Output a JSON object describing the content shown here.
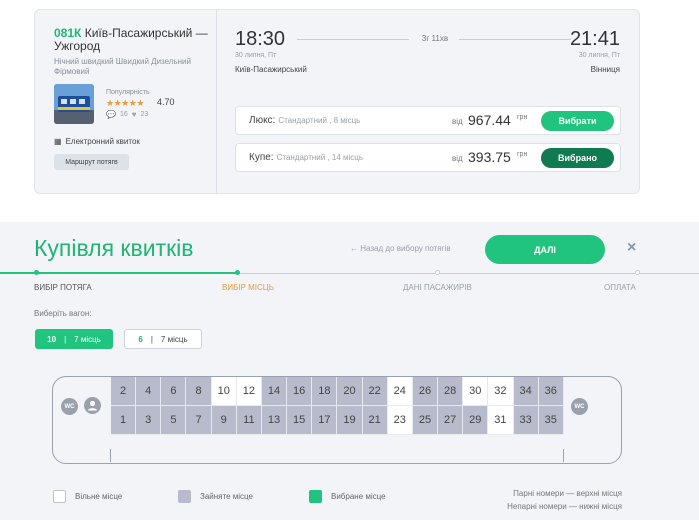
{
  "train": {
    "number": "081К",
    "route": "Київ-Пасажирський — Ужгород",
    "type": "Нічний швидкий Швидкий Дизельний Фірмовий",
    "popularity_label": "Популярність",
    "rating_stars": 4.5,
    "rating": "4.70",
    "comments": "16",
    "likes": "23",
    "eticket": "Електронний квиток",
    "route_button": "Маршрут потягв",
    "photo_icon": "train-photo"
  },
  "schedule": {
    "dep_time": "18:30",
    "arr_time": "21:41",
    "duration": "3г 11хв",
    "dep_date": "30 липня, Пт",
    "arr_date": "30 липня, Пт",
    "dep_station": "Київ-Пасажирський",
    "arr_station": "Вінниця"
  },
  "classes": [
    {
      "name": "Люкс:",
      "avail": "Стандартний , 8 місць",
      "from": "від",
      "price": "967.44",
      "currency": "грн",
      "button": "Вибрати"
    },
    {
      "name": "Купе:",
      "avail": "Стандартний , 14 місць",
      "from": "від",
      "price": "393.75",
      "currency": "грн",
      "button": "Вибрано"
    }
  ],
  "purchase": {
    "title": "Купівля квитків",
    "back": "← Назад до вибору потягів",
    "next": "ДАЛІ",
    "close": "×"
  },
  "steps": [
    {
      "label": "ВИБІР ПОТЯГА",
      "state": "done"
    },
    {
      "label": "ВИБІР МІСЦЬ",
      "state": "active"
    },
    {
      "label": "ДАНІ ПАСАЖИРІВ",
      "state": "todo"
    },
    {
      "label": "ОПЛАТА",
      "state": "todo"
    }
  ],
  "wagon": {
    "choose_label": "Виберіть вагон:",
    "tabs": [
      {
        "num": "10",
        "sep": "|",
        "places": "7 місць",
        "selected": true
      },
      {
        "num": "6",
        "sep": "|",
        "places": "7 місць",
        "selected": false
      }
    ]
  },
  "car": {
    "wc": "WC",
    "upper": [
      {
        "n": "2",
        "free": false
      },
      {
        "n": "4",
        "free": false
      },
      {
        "n": "6",
        "free": false
      },
      {
        "n": "8",
        "free": false
      },
      {
        "n": "10",
        "free": true
      },
      {
        "n": "12",
        "free": true
      },
      {
        "n": "14",
        "free": false
      },
      {
        "n": "16",
        "free": false
      },
      {
        "n": "18",
        "free": false
      },
      {
        "n": "20",
        "free": false
      },
      {
        "n": "22",
        "free": false
      },
      {
        "n": "24",
        "free": true
      },
      {
        "n": "26",
        "free": false
      },
      {
        "n": "28",
        "free": false
      },
      {
        "n": "30",
        "free": true
      },
      {
        "n": "32",
        "free": true
      },
      {
        "n": "34",
        "free": false
      },
      {
        "n": "36",
        "free": false
      }
    ],
    "lower": [
      {
        "n": "1",
        "free": false
      },
      {
        "n": "3",
        "free": false
      },
      {
        "n": "5",
        "free": false
      },
      {
        "n": "7",
        "free": false
      },
      {
        "n": "9",
        "free": false
      },
      {
        "n": "11",
        "free": false
      },
      {
        "n": "13",
        "free": false
      },
      {
        "n": "15",
        "free": false
      },
      {
        "n": "17",
        "free": false
      },
      {
        "n": "19",
        "free": false
      },
      {
        "n": "21",
        "free": false
      },
      {
        "n": "23",
        "free": true
      },
      {
        "n": "25",
        "free": false
      },
      {
        "n": "27",
        "free": false
      },
      {
        "n": "29",
        "free": false
      },
      {
        "n": "31",
        "free": true
      },
      {
        "n": "33",
        "free": false
      },
      {
        "n": "35",
        "free": false
      }
    ]
  },
  "legend": {
    "free": "Вільне місце",
    "occupied": "Зайняте місце",
    "selected": "Вибране місце",
    "even_note": "Парні номери — верхні місця",
    "odd_note": "Непарні номери — нижні місця"
  },
  "colors": {
    "accent": "#20c47e",
    "accent_dark": "#107a51",
    "occupied": "#b7bbcb",
    "active_step": "#e99a3c"
  }
}
